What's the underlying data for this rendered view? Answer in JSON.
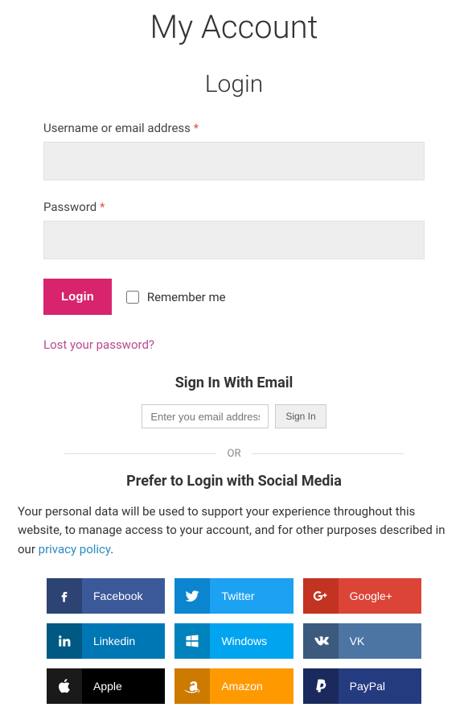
{
  "page_title": "My Account",
  "login": {
    "heading": "Login",
    "username_label": "Username or email address",
    "password_label": "Password",
    "required_marker": "*",
    "submit_label": "Login",
    "remember_label": "Remember me",
    "lost_password_label": "Lost your password?"
  },
  "email_signin": {
    "heading": "Sign In With Email",
    "placeholder": "Enter you email address",
    "button_label": "Sign In"
  },
  "divider_text": "OR",
  "social_heading": "Prefer to Login with Social Media",
  "privacy": {
    "text_before": "Your personal data will be used to support your experience throughout this website, to manage access to your account, and for other purposes described in our ",
    "link_label": "privacy policy",
    "text_after": "."
  },
  "social_buttons": [
    {
      "id": "facebook",
      "label": "Facebook",
      "class": "fb"
    },
    {
      "id": "twitter",
      "label": "Twitter",
      "class": "tw"
    },
    {
      "id": "google-plus",
      "label": "Google+",
      "class": "gp"
    },
    {
      "id": "linkedin",
      "label": "Linkedin",
      "class": "li"
    },
    {
      "id": "windows",
      "label": "Windows",
      "class": "wn"
    },
    {
      "id": "vk",
      "label": "VK",
      "class": "vk"
    },
    {
      "id": "apple",
      "label": "Apple",
      "class": "ap"
    },
    {
      "id": "amazon",
      "label": "Amazon",
      "class": "az"
    },
    {
      "id": "paypal",
      "label": "PayPal",
      "class": "pp"
    }
  ]
}
